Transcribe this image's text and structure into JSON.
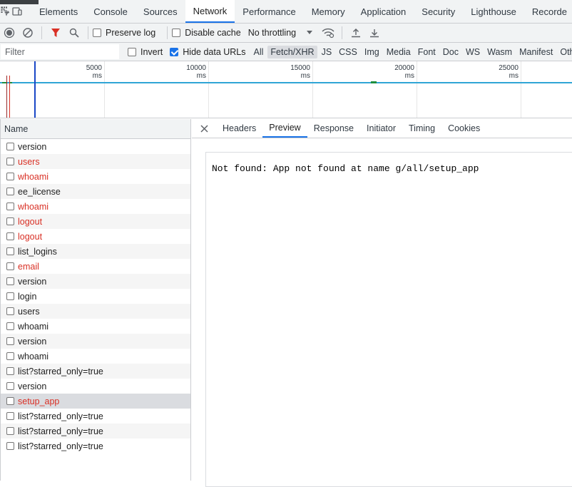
{
  "devtools": {
    "tabs": [
      {
        "label": "Elements",
        "active": false
      },
      {
        "label": "Console",
        "active": false
      },
      {
        "label": "Sources",
        "active": false
      },
      {
        "label": "Network",
        "active": true
      },
      {
        "label": "Performance",
        "active": false
      },
      {
        "label": "Memory",
        "active": false
      },
      {
        "label": "Application",
        "active": false
      },
      {
        "label": "Security",
        "active": false
      },
      {
        "label": "Lighthouse",
        "active": false
      },
      {
        "label": "Recorde",
        "active": false
      }
    ]
  },
  "toolbar": {
    "preserve_log": "Preserve log",
    "disable_cache": "Disable cache",
    "throttling": "No throttling"
  },
  "filterbar": {
    "placeholder": "Filter",
    "invert": "Invert",
    "hide_data_urls": "Hide data URLs",
    "types": [
      "All",
      "Fetch/XHR",
      "JS",
      "CSS",
      "Img",
      "Media",
      "Font",
      "Doc",
      "WS",
      "Wasm",
      "Manifest",
      "Other"
    ],
    "active_type": "Fetch/XHR"
  },
  "overview": {
    "ticks": [
      "5000 ms",
      "10000 ms",
      "15000 ms",
      "20000 ms",
      "25000 ms"
    ]
  },
  "requests": {
    "header": "Name",
    "rows": [
      {
        "name": "version",
        "error": false
      },
      {
        "name": "users",
        "error": true
      },
      {
        "name": "whoami",
        "error": true
      },
      {
        "name": "ee_license",
        "error": false
      },
      {
        "name": "whoami",
        "error": true
      },
      {
        "name": "logout",
        "error": true
      },
      {
        "name": "logout",
        "error": true
      },
      {
        "name": "list_logins",
        "error": false
      },
      {
        "name": "email",
        "error": true
      },
      {
        "name": "version",
        "error": false
      },
      {
        "name": "login",
        "error": false
      },
      {
        "name": "users",
        "error": false
      },
      {
        "name": "whoami",
        "error": false
      },
      {
        "name": "version",
        "error": false
      },
      {
        "name": "whoami",
        "error": false
      },
      {
        "name": "list?starred_only=true",
        "error": false
      },
      {
        "name": "version",
        "error": false
      },
      {
        "name": "setup_app",
        "error": true,
        "selected": true
      },
      {
        "name": "list?starred_only=true",
        "error": false
      },
      {
        "name": "list?starred_only=true",
        "error": false
      },
      {
        "name": "list?starred_only=true",
        "error": false
      }
    ]
  },
  "detail": {
    "tabs": [
      "Headers",
      "Preview",
      "Response",
      "Initiator",
      "Timing",
      "Cookies"
    ],
    "active_tab": "Preview",
    "preview_text": "Not found: App not found at name g/all/setup_app"
  },
  "colors": {
    "accent": "#1a73e8",
    "error": "#d93025",
    "filter_active": "#d93025"
  }
}
